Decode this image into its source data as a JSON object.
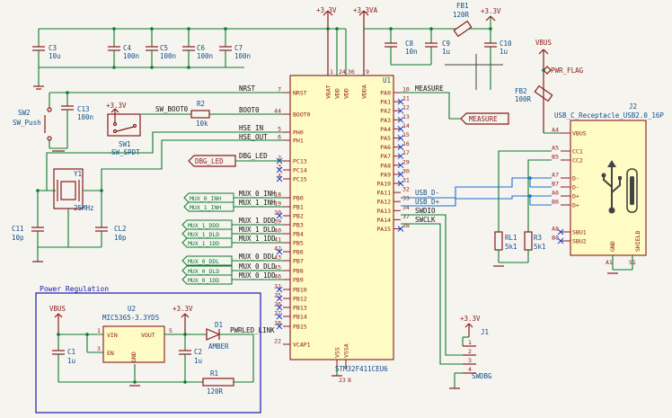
{
  "power": {
    "v33": "+3.3V",
    "v33a": "+3.3VA",
    "vbus": "VBUS",
    "pwr_flag": "PWR_FLAG"
  },
  "caps": {
    "c3": {
      "ref": "C3",
      "val": "10u"
    },
    "c4": {
      "ref": "C4",
      "val": "100n"
    },
    "c5": {
      "ref": "C5",
      "val": "100n"
    },
    "c6": {
      "ref": "C6",
      "val": "100n"
    },
    "c7": {
      "ref": "C7",
      "val": "100n"
    },
    "c8": {
      "ref": "C8",
      "val": "10n"
    },
    "c9": {
      "ref": "C9",
      "val": "1u"
    },
    "c10": {
      "ref": "C10",
      "val": "1u"
    },
    "c13": {
      "ref": "C13",
      "val": "100n"
    },
    "c11": {
      "ref": "C11",
      "val": "10p"
    },
    "cl2": {
      "ref": "CL2",
      "val": "10p"
    },
    "c1": {
      "ref": "C1",
      "val": "1u"
    },
    "c2": {
      "ref": "C2",
      "val": "1u"
    }
  },
  "fb1": {
    "ref": "FB1",
    "val": "120R"
  },
  "fb2": {
    "ref": "FB2",
    "val": "100R"
  },
  "sw2": {
    "ref": "SW2",
    "val": "SW_Push"
  },
  "sw1": {
    "ref": "SW1",
    "val": "SW_SPDT",
    "net": "SW_BOOT0"
  },
  "r2": {
    "ref": "R2",
    "val": "10k"
  },
  "y1": {
    "ref": "Y1",
    "val": "25MHz"
  },
  "dbg_led_label": "DBG_LED",
  "mux_labels": [
    "MUX_0_INH",
    "MUX_1_INH",
    "MUX_1_DDD",
    "MUX_1_DLD",
    "MUX_1_1DD",
    "MUX_0_DDL",
    "MUX_0_DLD",
    "MUX_0_1DD"
  ],
  "u1": {
    "ref": "U1",
    "part": "STM32F411CEU6",
    "top_pins": [
      "VBAT",
      "VDD",
      "VDD",
      "VDDA"
    ],
    "top_nums": [
      "1",
      "24",
      "36",
      "9"
    ],
    "left_pins": [
      "NRST",
      "BOOT0",
      "PH0",
      "PH1",
      "PC13",
      "PC14",
      "PC15",
      "PB0",
      "PB1",
      "PB2",
      "PB3",
      "PB4",
      "PB5",
      "PB6",
      "PB7",
      "PB8",
      "PB9",
      "PB10",
      "PB12",
      "PB13",
      "PB14",
      "PB15",
      "VCAP1"
    ],
    "left_nums": [
      "7",
      "44",
      "5",
      "6",
      "2",
      "3",
      "4",
      "18",
      "19",
      "20",
      "39",
      "40",
      "41",
      "42",
      "43",
      "45",
      "46",
      "21",
      "25",
      "26",
      "27",
      "28",
      "22"
    ],
    "right_pins": [
      "PA0",
      "PA1",
      "PA2",
      "PA3",
      "PA4",
      "PA5",
      "PA6",
      "PA7",
      "PA8",
      "PA9",
      "PA10",
      "PA11",
      "PA12",
      "PA13",
      "PA14",
      "PA15"
    ],
    "right_nums": [
      "10",
      "11",
      "12",
      "13",
      "14",
      "15",
      "16",
      "17",
      "29",
      "30",
      "31",
      "32",
      "33",
      "34",
      "37",
      "38"
    ],
    "bottom_pins": [
      "VSS",
      "VSSA"
    ],
    "bottom_nums": [
      "23",
      "8"
    ]
  },
  "nets": {
    "nrst": "NRST",
    "boot0": "BOOT0",
    "hse_in": "HSE_IN",
    "hse_out": "HSE_OUT",
    "dbg_led": "DBG_LED",
    "measure": "MEASURE",
    "usb_dm": "USB_D-",
    "usb_dp": "USB_D+",
    "swdio": "SWDIO",
    "swclk": "SWCLK",
    "left_mux": [
      "MUX_0_INH",
      "MUX_1_INH",
      "MUX_1_DDD",
      "MUX_1_DLD",
      "MUX_1_1DD",
      "MUX_0_DDL",
      "MUX_0_DLD",
      "MUX_0_1DD"
    ]
  },
  "measure_label": "MEASURE",
  "j2": {
    "ref": "J2",
    "val": "USB_C_Receptacle_USB2.0_16P",
    "pins": [
      "VBUS",
      "CC1",
      "CC2",
      "D-",
      "D-",
      "D+",
      "D+",
      "SBU1",
      "SBU2",
      "GND",
      "SHIELD"
    ],
    "nums": [
      "A4",
      "A5",
      "B5",
      "A7",
      "B7",
      "A6",
      "B6",
      "A8",
      "B8",
      "A1",
      "S1"
    ]
  },
  "rl1": {
    "ref": "RL1",
    "val": "5k1"
  },
  "r3": {
    "ref": "R3",
    "val": "5k1"
  },
  "j1": {
    "ref": "J1",
    "val": "SWDBG",
    "nums": [
      "1",
      "2",
      "3",
      "4"
    ]
  },
  "power_reg": {
    "title": "Power Regulation",
    "u2": {
      "ref": "U2",
      "part": "MIC5365-3.3YD5",
      "pins": [
        "VIN",
        "EN",
        "GND",
        "VOUT"
      ],
      "nums": [
        "1",
        "3",
        "2",
        "5"
      ]
    },
    "d1": {
      "ref": "D1",
      "val": "AMBER",
      "net": "PWRLED_LINK"
    },
    "r1": {
      "ref": "R1",
      "val": "120R"
    }
  }
}
